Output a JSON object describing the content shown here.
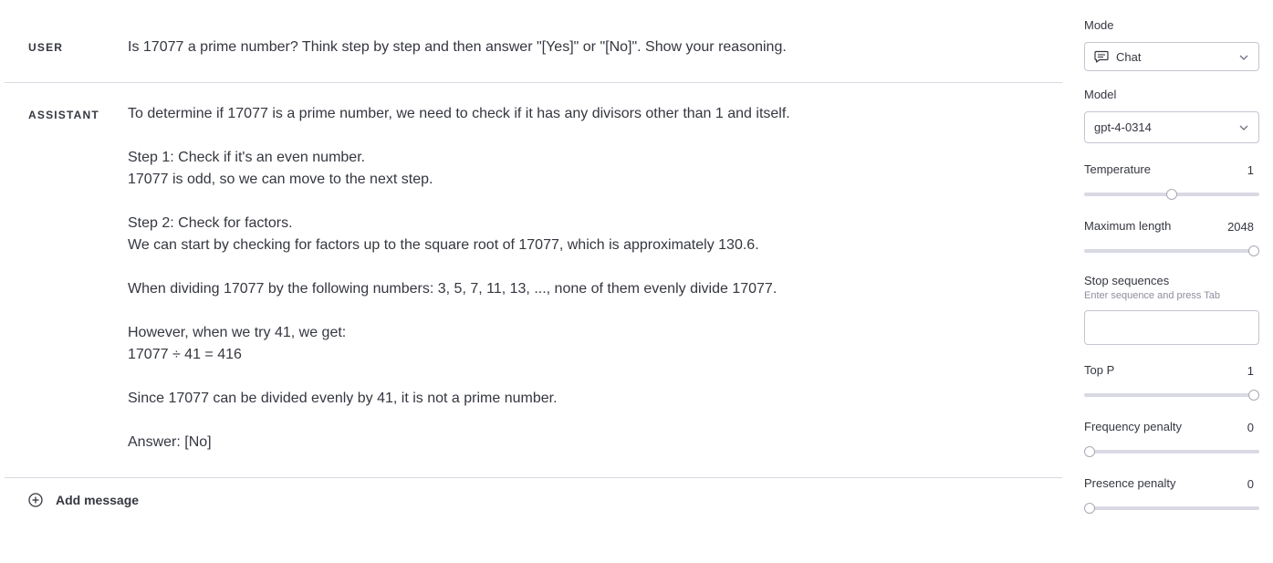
{
  "messages": {
    "user": {
      "role": "USER",
      "text": "Is 17077 a prime number? Think step by step and then answer \"[Yes]\" or \"[No]\". Show your reasoning."
    },
    "assistant": {
      "role": "ASSISTANT",
      "lines": [
        "To determine if 17077 is a prime number, we need to check if it has any divisors other than 1 and itself.",
        "",
        "Step 1: Check if it's an even number.",
        "17077 is odd, so we can move to the next step.",
        "",
        "Step 2: Check for factors.",
        "We can start by checking for factors up to the square root of 17077, which is approximately 130.6.",
        "",
        "When dividing 17077 by the following numbers: 3, 5, 7, 11, 13, ..., none of them evenly divide 17077.",
        "",
        "However, when we try 41, we get:",
        "17077 ÷ 41 = 416",
        "",
        "Since 17077 can be divided evenly by 41, it is not a prime number.",
        "",
        "Answer: [No]"
      ]
    }
  },
  "add_message": {
    "label": "Add message",
    "icon": "plus-circle-icon"
  },
  "settings": {
    "mode": {
      "label": "Mode",
      "value": "Chat",
      "icon": "chat-icon"
    },
    "model": {
      "label": "Model",
      "value": "gpt-4-0314"
    },
    "temperature": {
      "label": "Temperature",
      "value": "1",
      "fraction": 0.5
    },
    "max_length": {
      "label": "Maximum length",
      "value": "2048",
      "fraction": 1.0
    },
    "stop_sequences": {
      "label": "Stop sequences",
      "hint": "Enter sequence and press Tab",
      "value": ""
    },
    "top_p": {
      "label": "Top P",
      "value": "1",
      "fraction": 1.0
    },
    "frequency_penalty": {
      "label": "Frequency penalty",
      "value": "0",
      "fraction": 0.0
    },
    "presence_penalty": {
      "label": "Presence penalty",
      "value": "0",
      "fraction": 0.0
    }
  }
}
